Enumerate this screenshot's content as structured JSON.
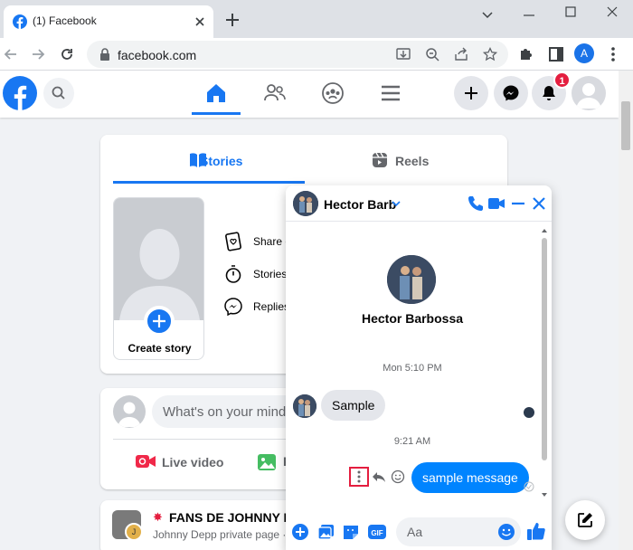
{
  "browser": {
    "tab_title": "(1) Facebook",
    "url": "facebook.com",
    "profile_initial": "A"
  },
  "header": {
    "notification_count": "1",
    "brand_color": "#1877f2"
  },
  "stories": {
    "tab_stories": "Stories",
    "tab_reels": "Reels",
    "create_story": "Create story",
    "rows": [
      "Share e",
      "Stories",
      "Replies"
    ]
  },
  "composer": {
    "placeholder": "What's on your mind",
    "live_video": "Live video",
    "photo_video": "P"
  },
  "group_post": {
    "name": "FANS DE JOHNNY DE",
    "subtitle": "Johnny Depp private page ·",
    "badge_letter": "J"
  },
  "chat": {
    "contact_short": "Hector Barb",
    "contact_full": "Hector Barbossa",
    "time_1": "Mon 5:10 PM",
    "incoming_message": "Sample",
    "time_2": "9:21 AM",
    "outgoing_message": "sample message",
    "input_placeholder": "Aa"
  }
}
